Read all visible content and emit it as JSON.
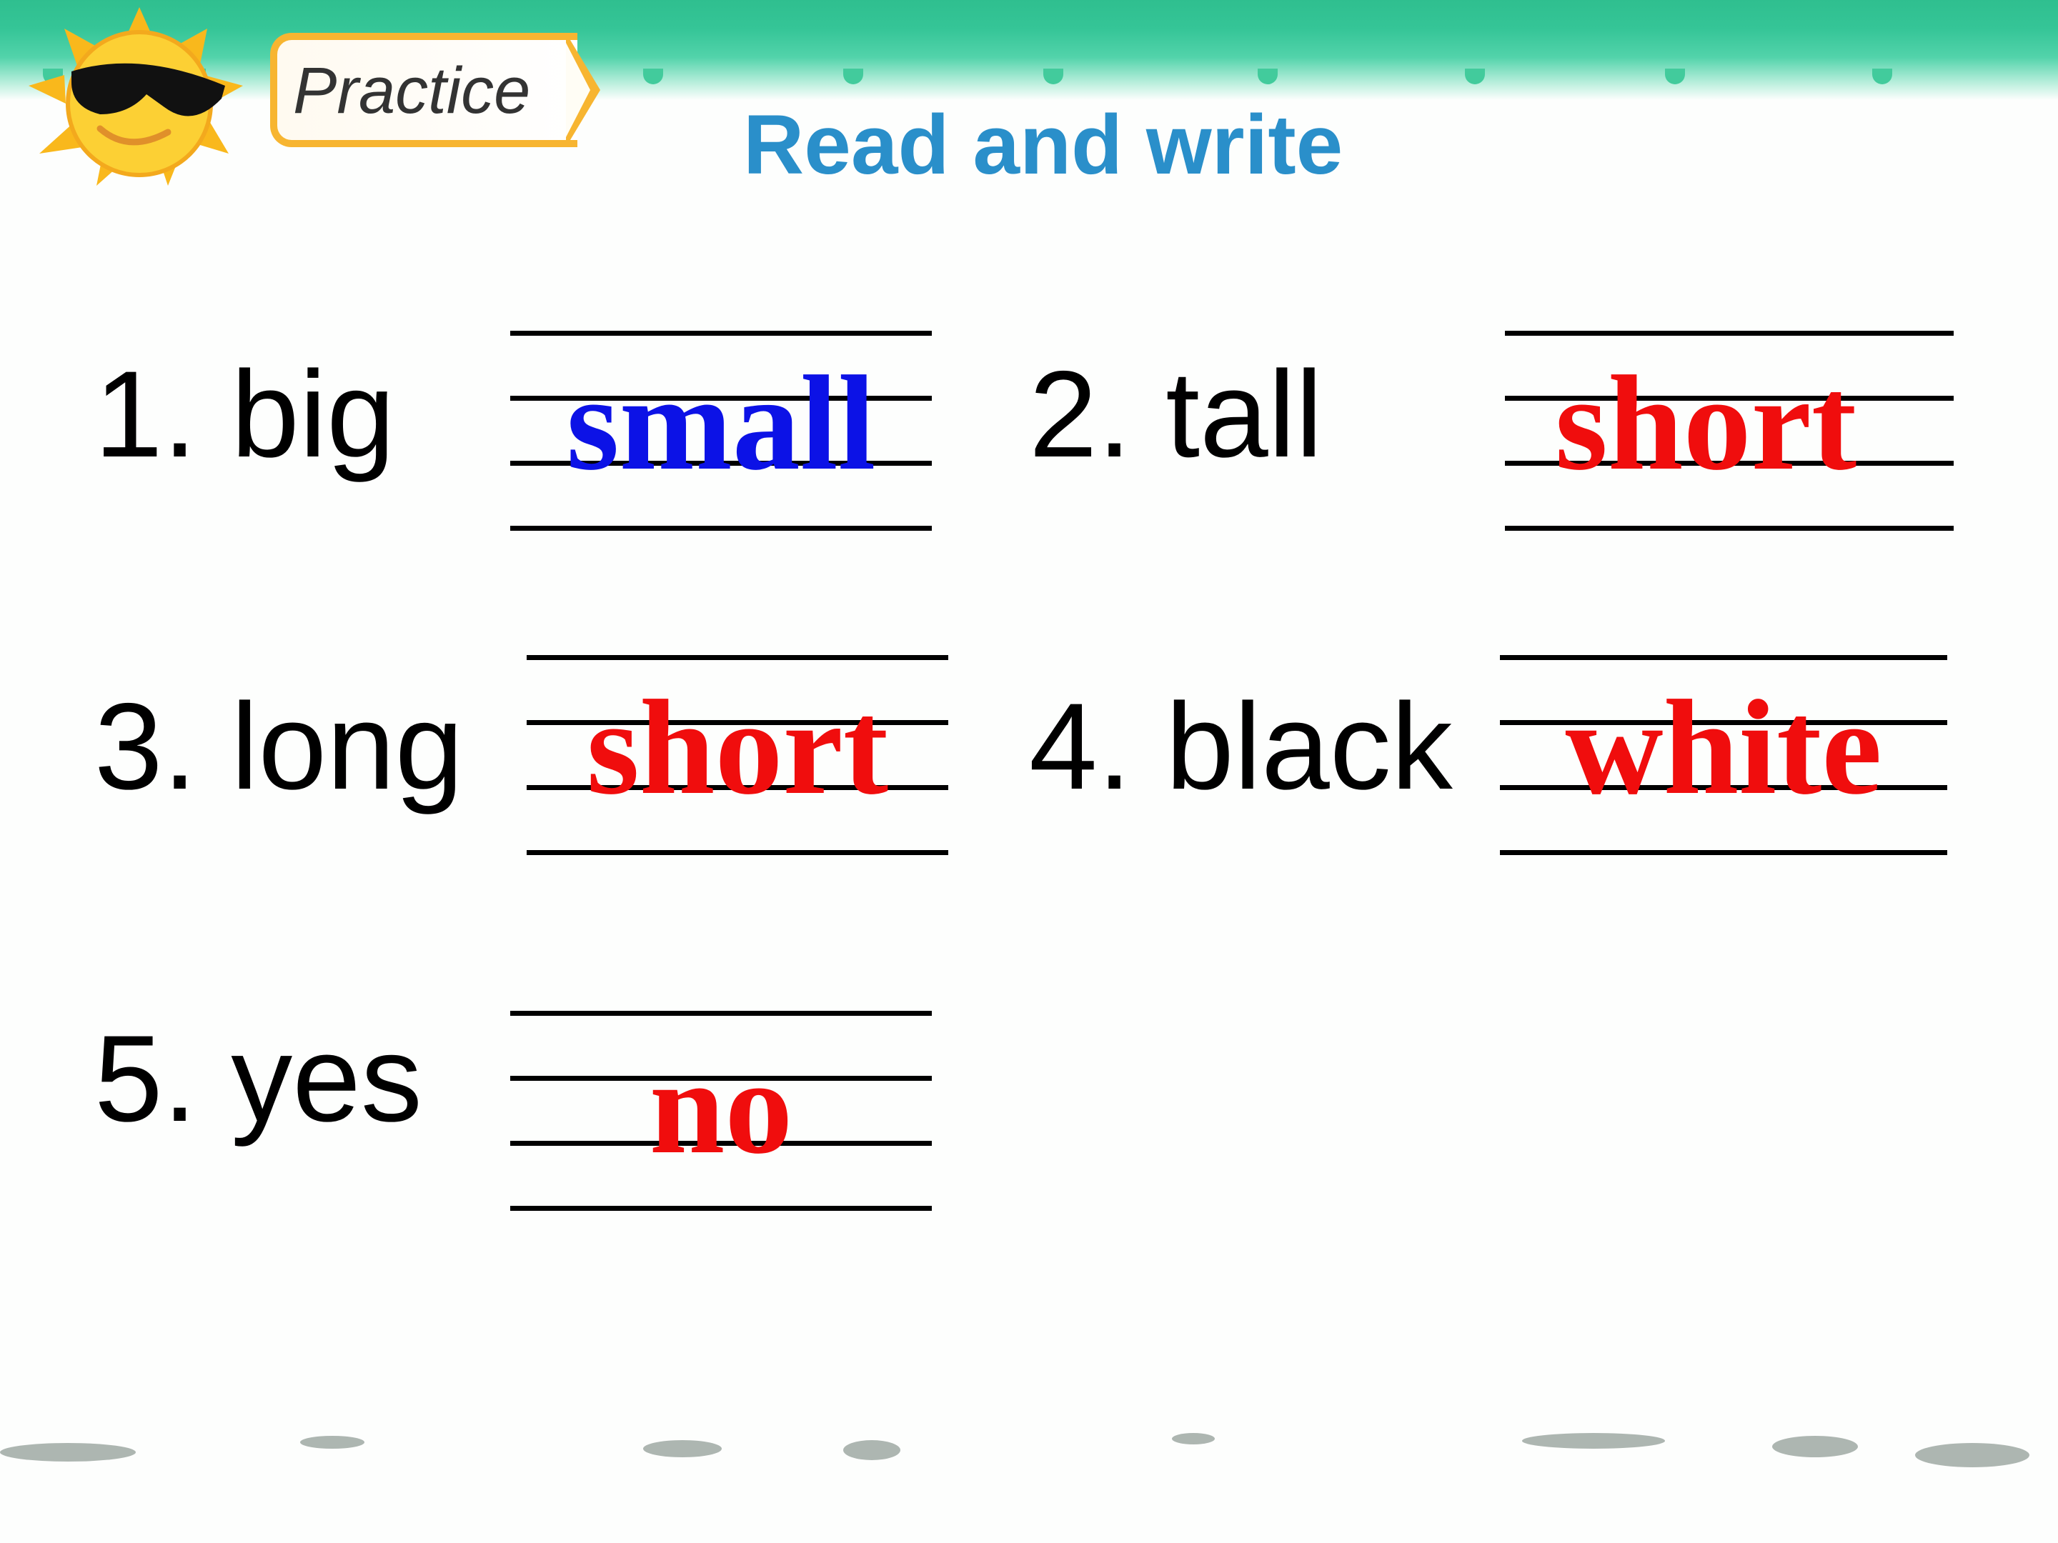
{
  "header": {
    "badge_label": "Practice",
    "title": "Read and write"
  },
  "colors": {
    "title": "#2a8fca",
    "answer_blue": "#0c12e6",
    "answer_red": "#f00d0d",
    "band_green": "#35c597",
    "badge_orange": "#f7b531"
  },
  "exercises": [
    {
      "prompt": "1. big",
      "answer": "small",
      "answer_color": "#0c12e6"
    },
    {
      "prompt": "2. tall",
      "answer": "short",
      "answer_color": "#f00d0d"
    },
    {
      "prompt": "3. long",
      "answer": "short",
      "answer_color": "#f00d0d"
    },
    {
      "prompt": "4. black",
      "answer": "white",
      "answer_color": "#f00d0d"
    },
    {
      "prompt": "5. yes",
      "answer": "no",
      "answer_color": "#f00d0d"
    }
  ],
  "icons": {
    "mascot": "sun-with-sunglasses-icon"
  }
}
